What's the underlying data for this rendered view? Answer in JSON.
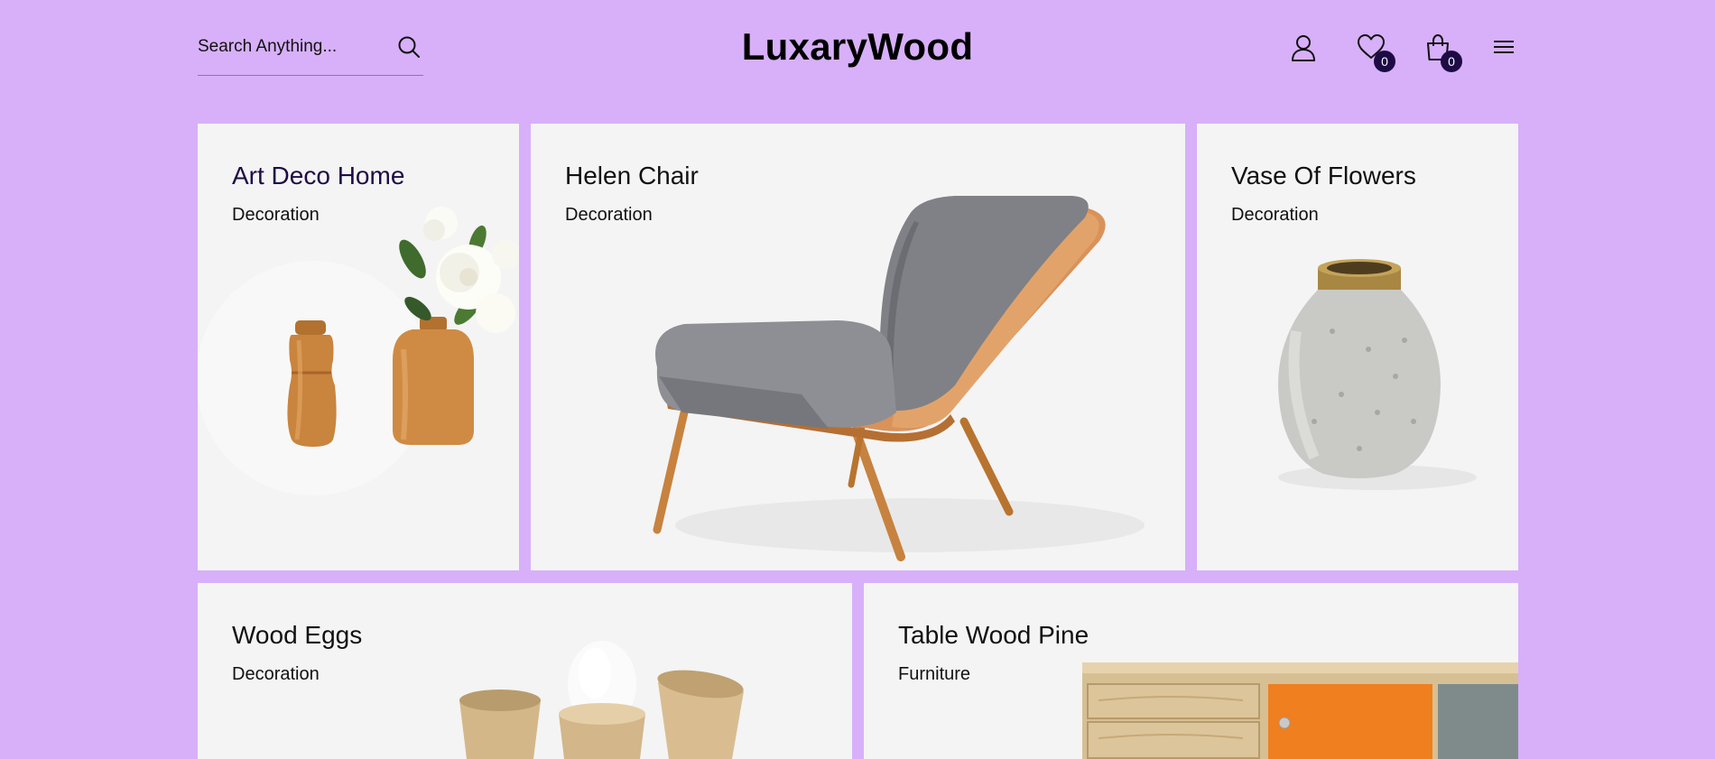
{
  "header": {
    "search_placeholder": "Search Anything...",
    "logo": "LuxaryWood",
    "wishlist_count": "0",
    "cart_count": "0"
  },
  "products": [
    {
      "title": "Art Deco Home",
      "category": "Decoration"
    },
    {
      "title": "Helen Chair",
      "category": "Decoration"
    },
    {
      "title": "Vase Of Flowers",
      "category": "Decoration"
    },
    {
      "title": "Wood Eggs",
      "category": "Decoration"
    },
    {
      "title": "Table Wood Pine",
      "category": "Furniture"
    }
  ],
  "colors": {
    "background": "#d7b0f9",
    "card": "#f4f4f4",
    "badge": "#1e0b46",
    "accent_title": "#1e0b46"
  }
}
